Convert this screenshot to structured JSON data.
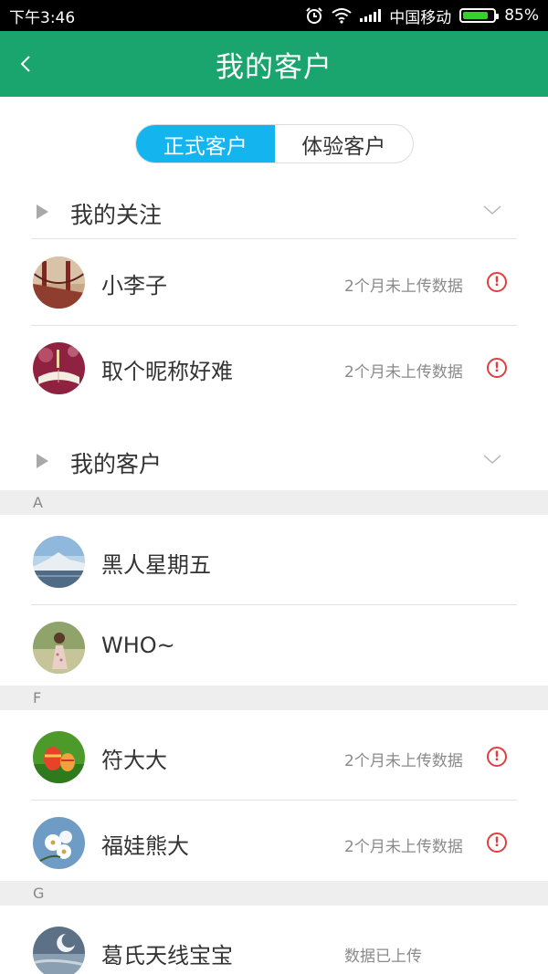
{
  "status_bar": {
    "time": "下午3:46",
    "carrier": "中国移动",
    "battery": "85%",
    "battery_level": 0.85,
    "icons": [
      "alarm-icon",
      "wifi-icon",
      "signal-icon",
      "battery-icon"
    ]
  },
  "header": {
    "title": "我的客户",
    "back_icon": "back-arrow-icon",
    "background": "#1aa56f"
  },
  "tabs": [
    {
      "label": "正式客户",
      "active": true
    },
    {
      "label": "体验客户",
      "active": false
    }
  ],
  "colors": {
    "accent": "#14b4ef",
    "warning": "#e43d3d"
  },
  "groups": {
    "favorites": {
      "title": "我的关注",
      "items": [
        {
          "name": "小李子",
          "status": "2个月未上传数据",
          "warning": true,
          "avatar": "bridge-photo"
        },
        {
          "name": "取个昵称好难",
          "status": "2个月未上传数据",
          "warning": true,
          "avatar": "book-photo"
        }
      ]
    },
    "customers": {
      "title": "我的客户",
      "sections": [
        {
          "letter": "A",
          "items": [
            {
              "name": "黑人星期五",
              "status": "",
              "warning": false,
              "avatar": "mountain-photo"
            },
            {
              "name": "WHO~",
              "status": "",
              "warning": false,
              "avatar": "girl-photo"
            }
          ]
        },
        {
          "letter": "F",
          "items": [
            {
              "name": "符大大",
              "status": "2个月未上传数据",
              "warning": true,
              "avatar": "easter-eggs-photo"
            },
            {
              "name": "福娃熊大",
              "status": "2个月未上传数据",
              "warning": true,
              "avatar": "flowers-photo"
            }
          ]
        },
        {
          "letter": "G",
          "items": [
            {
              "name": "葛氏天线宝宝",
              "status": "数据已上传",
              "warning": false,
              "avatar": "moon-sky-photo"
            }
          ]
        }
      ]
    }
  },
  "warning_glyph": "!"
}
